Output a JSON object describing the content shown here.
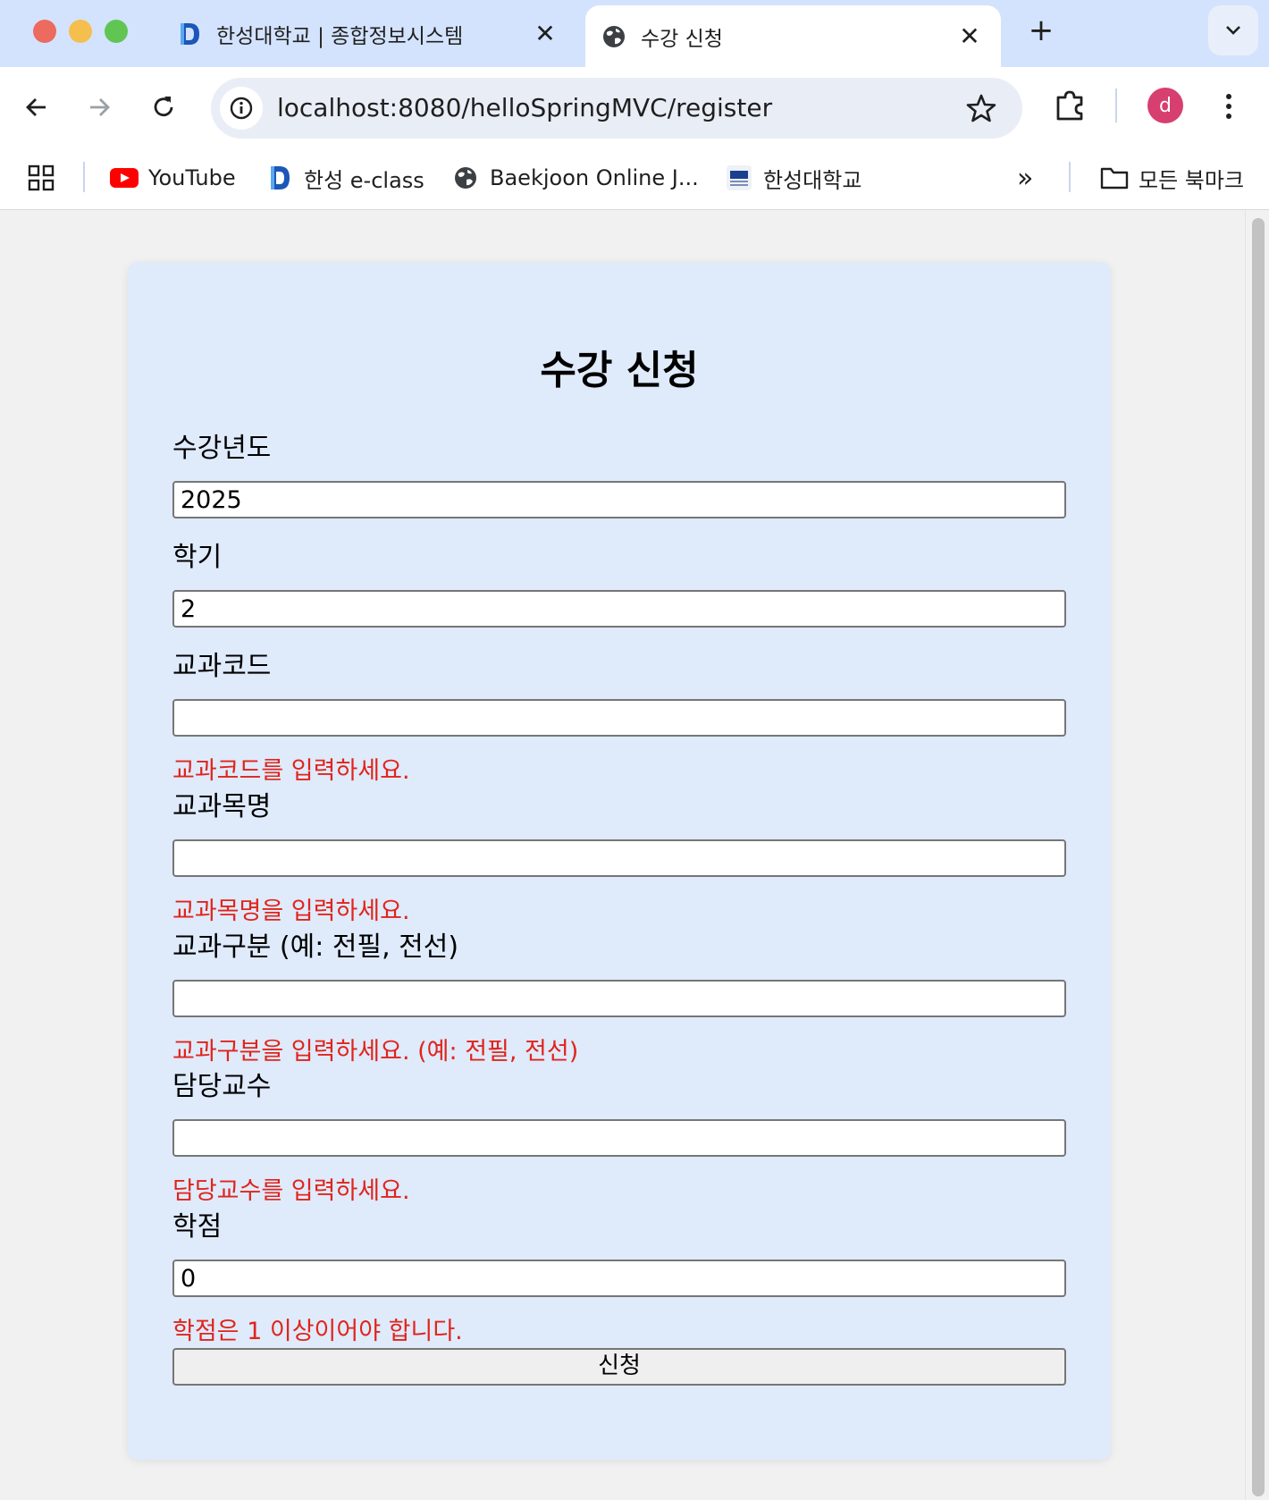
{
  "browser": {
    "tabs": [
      {
        "title": "한성대학교 | 종합정보시스템",
        "active": false
      },
      {
        "title": "수강 신청",
        "active": true
      }
    ],
    "close_glyph": "✕",
    "new_tab_glyph": "+",
    "url": "localhost:8080/helloSpringMVC/register",
    "avatar_letter": "d",
    "bookmarks": [
      {
        "label": "YouTube",
        "icon": "youtube-icon"
      },
      {
        "label": "한성 e-class",
        "icon": "hansung-eclass-icon"
      },
      {
        "label": "Baekjoon Online J...",
        "icon": "globe-icon"
      },
      {
        "label": "한성대학교",
        "icon": "hsu-logo-icon"
      }
    ],
    "overflow_glyph": "»",
    "all_bookmarks_label": "모든 북마크"
  },
  "form": {
    "title": "수강 신청",
    "fields": [
      {
        "label": "수강년도",
        "value": "2025",
        "error": ""
      },
      {
        "label": "학기",
        "value": "2",
        "error": ""
      },
      {
        "label": "교과코드",
        "value": "",
        "error": "교과코드를 입력하세요."
      },
      {
        "label": "교과목명",
        "value": "",
        "error": "교과목명을 입력하세요."
      },
      {
        "label": "교과구분 (예: 전필, 전선)",
        "value": "",
        "error": "교과구분을 입력하세요. (예: 전필, 전선)"
      },
      {
        "label": "담당교수",
        "value": "",
        "error": "담당교수를 입력하세요."
      },
      {
        "label": "학점",
        "value": "0",
        "error": "학점은 1 이상이어야 합니다."
      }
    ],
    "submit_label": "신청"
  },
  "colors": {
    "tabstrip": "#d3e3fd",
    "card": "#dfeafb",
    "error": "#e0241b",
    "avatar": "#d63f6f"
  }
}
